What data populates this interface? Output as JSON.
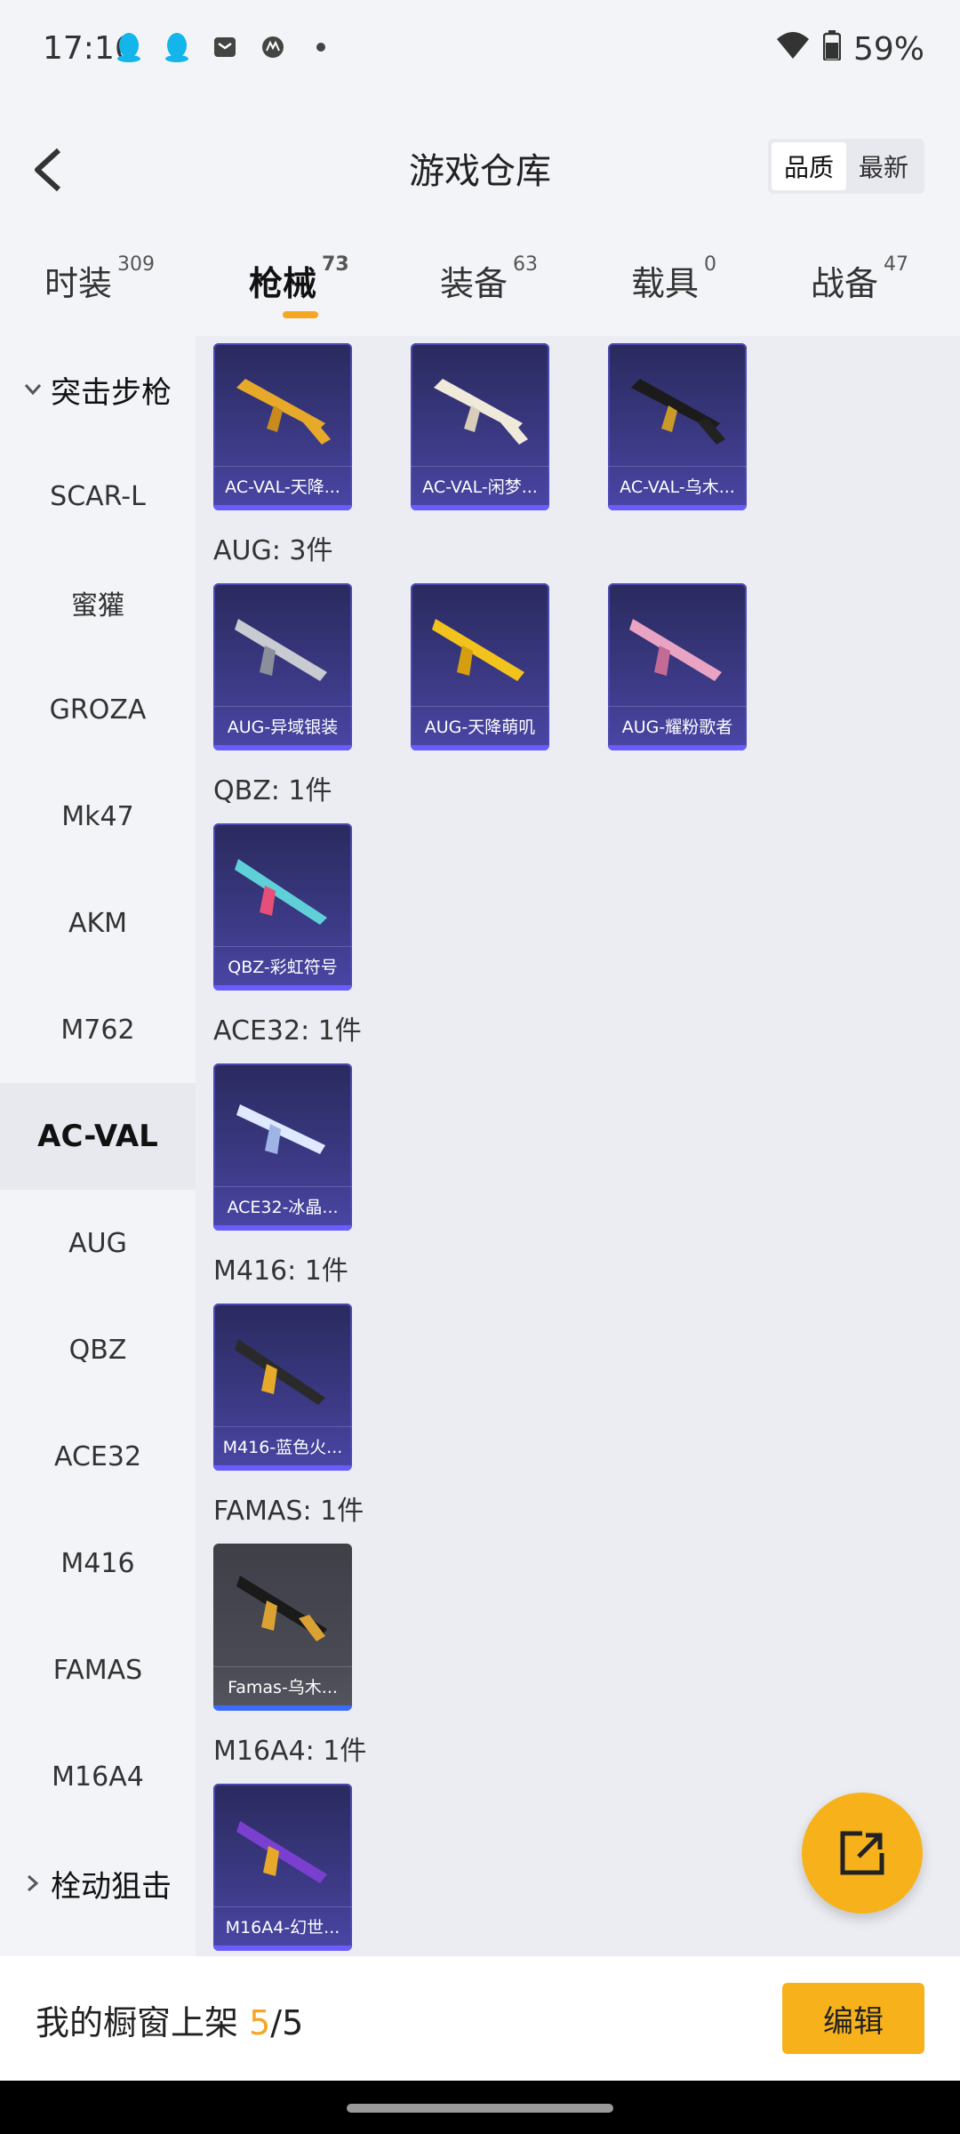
{
  "status_bar": {
    "time": "17:16",
    "battery": "59%",
    "icons": [
      "qq-icon",
      "qq-icon",
      "mail-icon",
      "motorola-icon",
      "dot-icon",
      "wifi-icon",
      "battery-icon"
    ]
  },
  "header": {
    "title": "游戏仓库",
    "sort_options": [
      "品质",
      "最新"
    ],
    "active_sort": "品质"
  },
  "tabs": [
    {
      "label": "时装",
      "count": "309"
    },
    {
      "label": "枪械",
      "count": "73",
      "active": true
    },
    {
      "label": "装备",
      "count": "63"
    },
    {
      "label": "载具",
      "count": "0"
    },
    {
      "label": "战备",
      "count": "47"
    }
  ],
  "sidebar": {
    "category_top": "突击步枪",
    "items": [
      "SCAR-L",
      "蜜獾",
      "GROZA",
      "Mk47",
      "AKM",
      "M762",
      "AC-VAL",
      "AUG",
      "QBZ",
      "ACE32",
      "M416",
      "FAMAS",
      "M16A4"
    ],
    "active": "AC-VAL",
    "category_bottom": "栓动狙击"
  },
  "sections": [
    {
      "title": "",
      "items": [
        "AC-VAL-天降...",
        "AC-VAL-闲梦...",
        "AC-VAL-乌木..."
      ]
    },
    {
      "title": "AUG: 3件",
      "items": [
        "AUG-异域银装",
        "AUG-天降萌叽",
        "AUG-耀粉歌者"
      ]
    },
    {
      "title": "QBZ: 1件",
      "items": [
        "QBZ-彩虹符号"
      ]
    },
    {
      "title": "ACE32: 1件",
      "items": [
        "ACE32-冰晶..."
      ]
    },
    {
      "title": "M416: 1件",
      "items": [
        "M416-蓝色火..."
      ]
    },
    {
      "title": "FAMAS: 1件",
      "items": [
        "Famas-乌木..."
      ]
    },
    {
      "title": "M16A4: 1件",
      "items": [
        "M16A4-幻世..."
      ]
    }
  ],
  "bottom": {
    "shelf_label": "我的橱窗上架",
    "shelf_count": "5",
    "shelf_total": "/5",
    "edit_label": "编辑"
  },
  "colors": {
    "accent": "#f7b21b",
    "card_purple": "#3c3a86",
    "gray_card": "#4a4a55"
  }
}
